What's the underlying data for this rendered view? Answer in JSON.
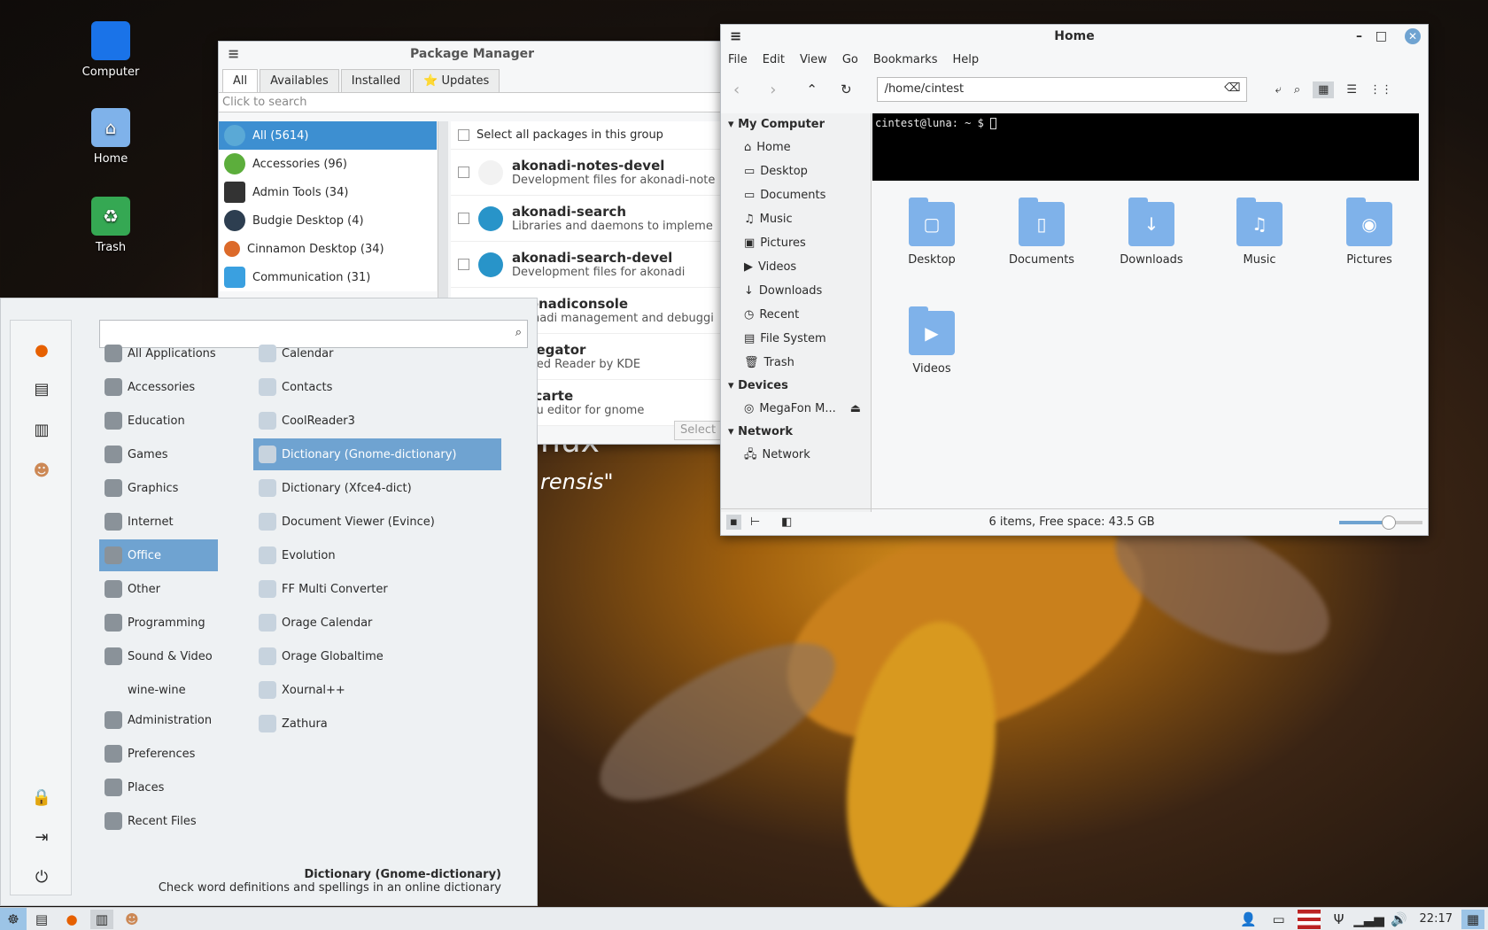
{
  "colors": {
    "accent": "#3d8fd1",
    "menu_selection": "#6fa3d1",
    "folder": "#7fb2ea"
  },
  "desktop": {
    "icons": [
      {
        "label": "Computer",
        "icon": "monitor-icon"
      },
      {
        "label": "Home",
        "icon": "home-folder-icon"
      },
      {
        "label": "Trash",
        "icon": "trash-icon"
      }
    ],
    "wallpaper_text": [
      "nux",
      "rensis\""
    ]
  },
  "package_manager": {
    "title": "Package Manager",
    "tabs": [
      "All",
      "Availables",
      "Installed",
      "⭐ Updates"
    ],
    "search_placeholder": "Click to search",
    "select_all_label": "Select all packages in this group",
    "groups": [
      {
        "label": "All (5614)",
        "selected": true
      },
      {
        "label": "Accessories (96)"
      },
      {
        "label": "Admin Tools (34)"
      },
      {
        "label": "Budgie Desktop (4)"
      },
      {
        "label": "Cinnamon Desktop (34)"
      },
      {
        "label": "Communication (31)"
      }
    ],
    "packages": [
      {
        "name": "akonadi-notes-devel",
        "desc": "Development files for akonadi-note"
      },
      {
        "name": "akonadi-search",
        "desc": "Libraries and daemons to impleme"
      },
      {
        "name": "akonadi-search-devel",
        "desc": "Development files for akonadi"
      },
      {
        "name": "akonadiconsole",
        "desc": "akonadi management and debuggi"
      },
      {
        "name": "akregator",
        "desc": "A Feed Reader by KDE"
      },
      {
        "name": "alacarte",
        "desc": "Menu editor for gnome"
      }
    ],
    "select_button": "Select"
  },
  "file_manager": {
    "title": "Home",
    "menu": [
      "File",
      "Edit",
      "View",
      "Go",
      "Bookmarks",
      "Help"
    ],
    "path": "/home/cintest",
    "sidebar": {
      "my_computer": "My Computer",
      "places": [
        "Home",
        "Desktop",
        "Documents",
        "Music",
        "Pictures",
        "Videos",
        "Downloads",
        "Recent",
        "File System",
        "Trash"
      ],
      "devices": "Devices",
      "device_items": [
        "MegaFon M..."
      ],
      "network": "Network",
      "network_items": [
        "Network"
      ]
    },
    "terminal_prompt": "cintest@luna: ~ $ ",
    "files": [
      "Desktop",
      "Documents",
      "Downloads",
      "Music",
      "Pictures",
      "Videos"
    ],
    "status": "6 items, Free space: 43.5 GB",
    "zoom_level": 0.6
  },
  "start_menu": {
    "categories": [
      "All Applications",
      "Accessories",
      "Education",
      "Games",
      "Graphics",
      "Internet",
      "Office",
      "Other",
      "Programming",
      "Sound & Video",
      "wine-wine",
      "Administration",
      "Preferences",
      "Places",
      "Recent Files"
    ],
    "selected_category": "Office",
    "apps": [
      "Calendar",
      "Contacts",
      "CoolReader3",
      "Dictionary (Gnome-dictionary)",
      "Dictionary (Xfce4-dict)",
      "Document Viewer (Evince)",
      "Evolution",
      "FF Multi Converter",
      "Orage Calendar",
      "Orage Globaltime",
      "Xournal++",
      "Zathura"
    ],
    "selected_app": "Dictionary (Gnome-dictionary)",
    "footer_title": "Dictionary (Gnome-dictionary)",
    "footer_desc": "Check word definitions and spellings in an online dictionary"
  },
  "taskbar": {
    "clock": "22:17"
  }
}
